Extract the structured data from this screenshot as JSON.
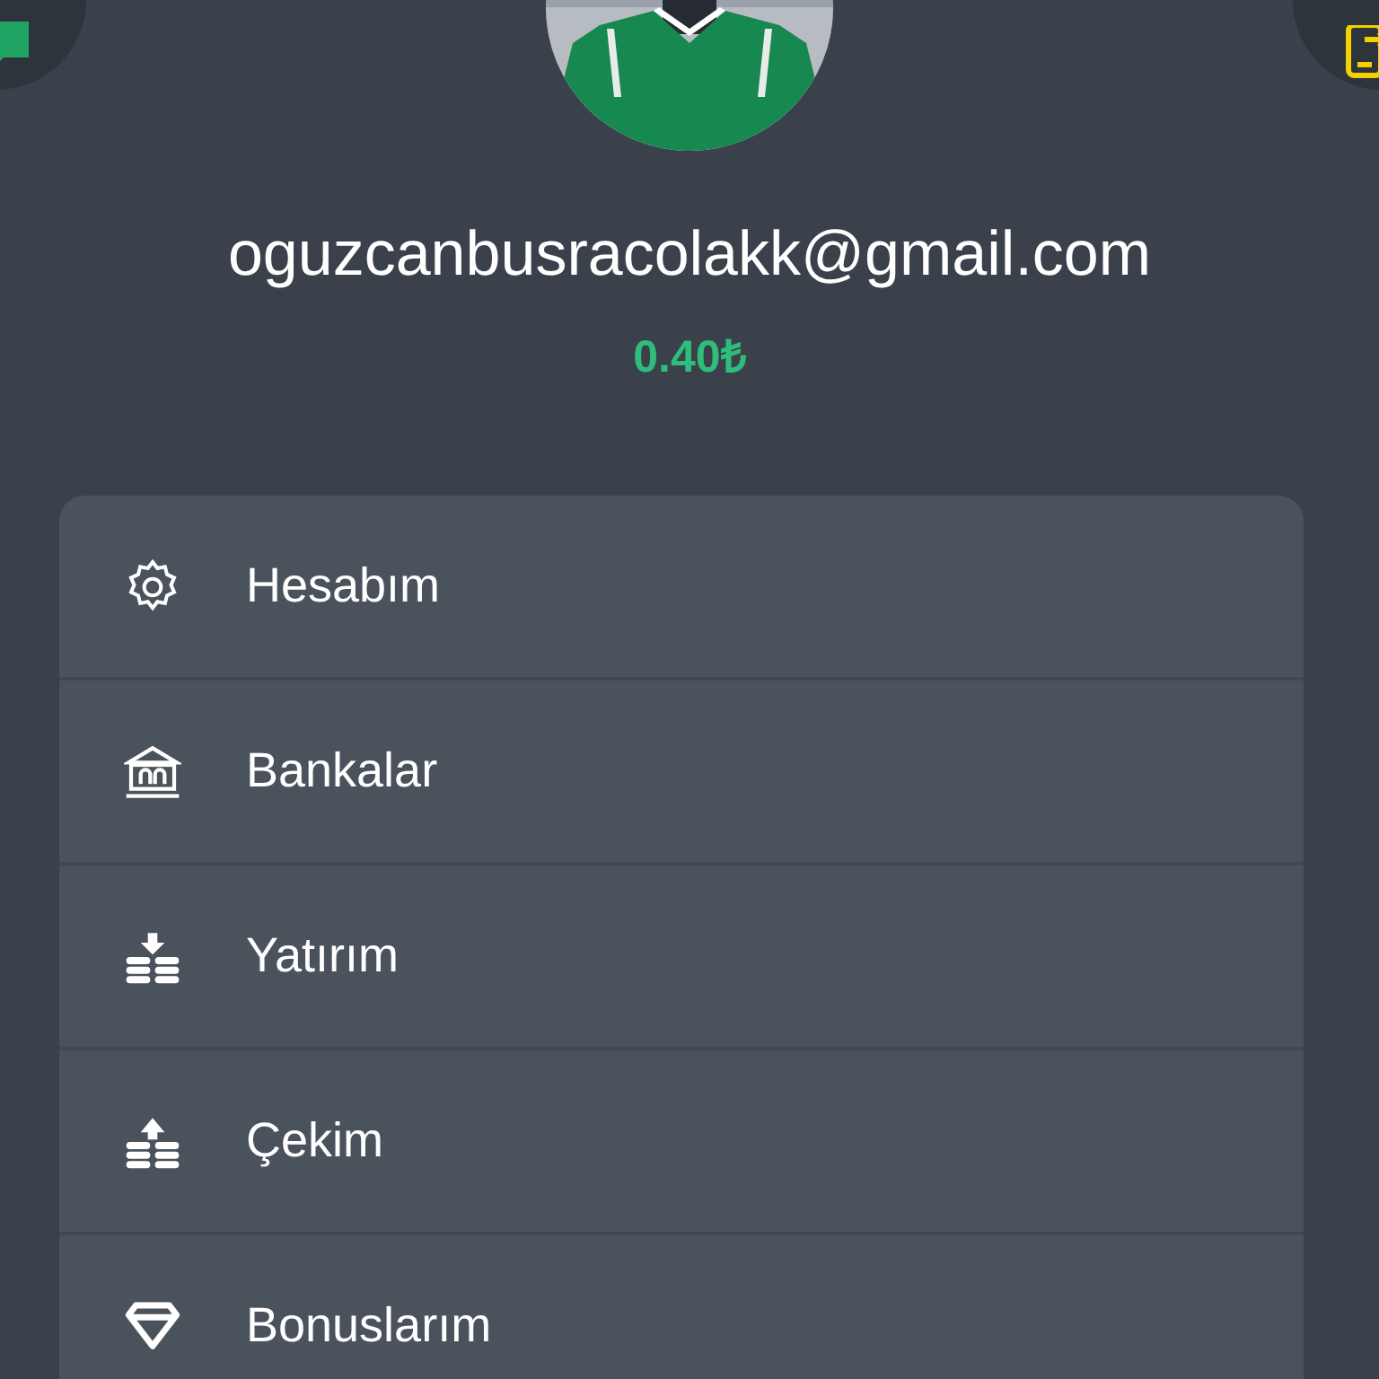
{
  "account": {
    "email": "oguzcanbusracolakk@gmail.com",
    "balance": "0.40₺"
  },
  "menu": [
    {
      "kind": "settings",
      "label": "Hesabım"
    },
    {
      "kind": "bank",
      "label": "Bankalar"
    },
    {
      "kind": "deposit",
      "label": "Yatırım"
    },
    {
      "kind": "withdraw",
      "label": "Çekim"
    },
    {
      "kind": "bonus",
      "label": "Bonuslarım"
    }
  ]
}
